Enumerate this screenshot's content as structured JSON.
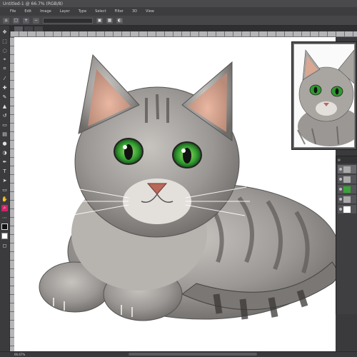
{
  "window": {
    "title": "Untitled-1 @ 66.7% (RGB/8)",
    "tab_right": ""
  },
  "menu": [
    "File",
    "Edit",
    "Image",
    "Layer",
    "Type",
    "Select",
    "Filter",
    "3D",
    "View"
  ],
  "options": {
    "field_value": ""
  },
  "tabs": [
    {
      "label": ""
    },
    {
      "label": ""
    },
    {
      "label": ""
    }
  ],
  "status": {
    "zoom": "66.67%",
    "doc": ""
  },
  "colors": {
    "accent": "#d0246a",
    "canvas": "#ffffff",
    "chrome": "#3a3a3c",
    "eye": "#3aa33a"
  }
}
